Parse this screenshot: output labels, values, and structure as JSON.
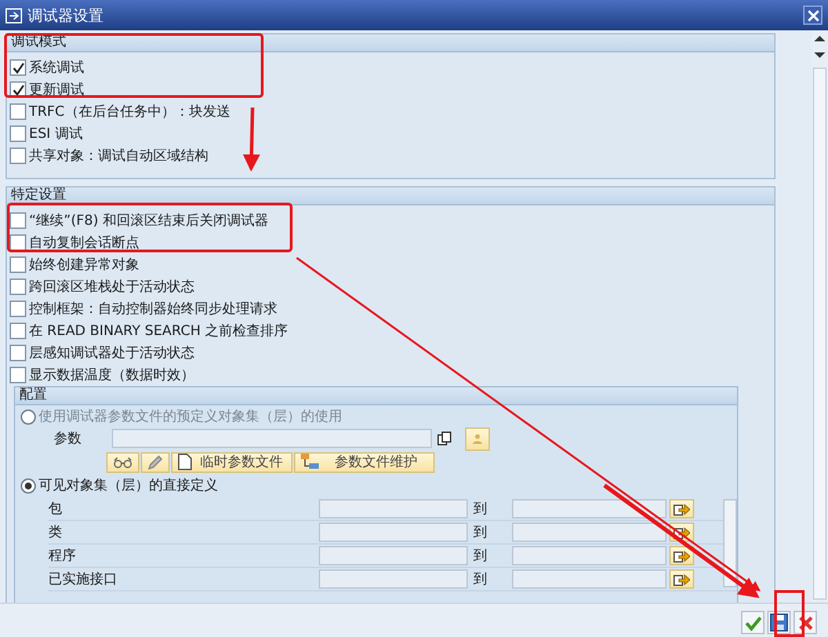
{
  "window": {
    "title": "调试器设置"
  },
  "groups": [
    {
      "title": "调试模式",
      "options": [
        {
          "label": "系统调试",
          "checked": true
        },
        {
          "label": "更新调试",
          "checked": true
        },
        {
          "label": "TRFC（在后台任务中）：块发送",
          "checked": false
        },
        {
          "label": "ESI 调试",
          "checked": false
        },
        {
          "label": "共享对象：调试自动区域结构",
          "checked": false
        }
      ]
    },
    {
      "title": "特定设置",
      "options": [
        {
          "label": "“继续”(F8) 和回滚区结束后关闭调试器",
          "checked": false
        },
        {
          "label": "自动复制会话断点",
          "checked": false
        },
        {
          "label": "始终创建异常对象",
          "checked": false
        },
        {
          "label": "跨回滚区堆栈处于活动状态",
          "checked": false
        },
        {
          "label": "控制框架：自动控制器始终同步处理请求",
          "checked": false
        },
        {
          "label": "在 READ BINARY SEARCH 之前检查排序",
          "checked": false
        },
        {
          "label": "层感知调试器处于活动状态",
          "checked": false
        },
        {
          "label": "显示数据温度（数据时效）",
          "checked": false
        }
      ]
    }
  ],
  "config": {
    "title": "配置",
    "modes": [
      {
        "label": "使用调试器参数文件的预定义对象集（层）的使用",
        "selected": false,
        "disabled": true
      },
      {
        "label": "可见对象集（层）的直接定义",
        "selected": true,
        "disabled": false
      }
    ],
    "parameter": {
      "label": "参数"
    },
    "buttons": [
      {
        "kind": "glasses"
      },
      {
        "kind": "pencil"
      },
      {
        "kind": "document",
        "label": "临时参数文件"
      },
      {
        "kind": "tree",
        "label": "参数文件维护"
      }
    ],
    "ranges": [
      {
        "label": "包",
        "to": "到"
      },
      {
        "label": "类",
        "to": "到"
      },
      {
        "label": "程序",
        "to": "到"
      },
      {
        "label": "已实施接口",
        "to": "到"
      }
    ]
  },
  "footer": {
    "buttons": [
      {
        "kind": "confirm"
      },
      {
        "kind": "save"
      },
      {
        "kind": "cancel"
      }
    ]
  }
}
